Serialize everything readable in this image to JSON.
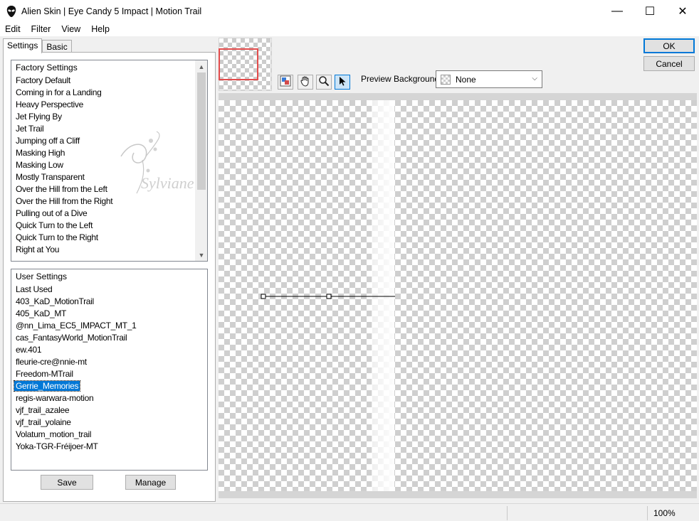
{
  "window": {
    "title": "Alien Skin | Eye Candy 5 Impact | Motion Trail",
    "minimize": "—",
    "maximize": "☐",
    "close": "✕"
  },
  "menu": [
    "Edit",
    "Filter",
    "View",
    "Help"
  ],
  "tabs": {
    "settings": "Settings",
    "basic": "Basic"
  },
  "factory": {
    "header": "Factory Settings",
    "items": [
      "Factory Default",
      "Coming in for a Landing",
      "Heavy Perspective",
      "Jet Flying By",
      "Jet Trail",
      "Jumping off a Cliff",
      "Masking High",
      "Masking Low",
      "Mostly Transparent",
      "Over the Hill from the Left",
      "Over the Hill from the Right",
      "Pulling out of a Dive",
      "Quick Turn to the Left",
      "Quick Turn to the Right",
      "Right at You"
    ]
  },
  "user": {
    "header": "User Settings",
    "items": [
      "Last Used",
      "403_KaD_MotionTrail",
      "405_KaD_MT",
      "@nn_Lima_EC5_IMPACT_MT_1",
      "cas_FantasyWorld_MotionTrail",
      "ew.401",
      "fleurie-cre@nnie-mt",
      "Freedom-MTrail",
      "Gerrie_Memories",
      "regis-warwara-motion",
      "vjf_trail_azalee",
      "vjf_trail_yolaine",
      "Volatum_motion_trail",
      "Yoka-TGR-Fréijoer-MT"
    ],
    "selected": "Gerrie_Memories"
  },
  "buttons": {
    "save": "Save",
    "manage": "Manage",
    "ok": "OK",
    "cancel": "Cancel"
  },
  "preview_background": {
    "label": "Preview Background:",
    "value": "None"
  },
  "watermark": "Sylviane",
  "status": {
    "zoom": "100%"
  },
  "colors": {
    "selection": "#0078d7",
    "nav_rect": "#e34c4c"
  }
}
